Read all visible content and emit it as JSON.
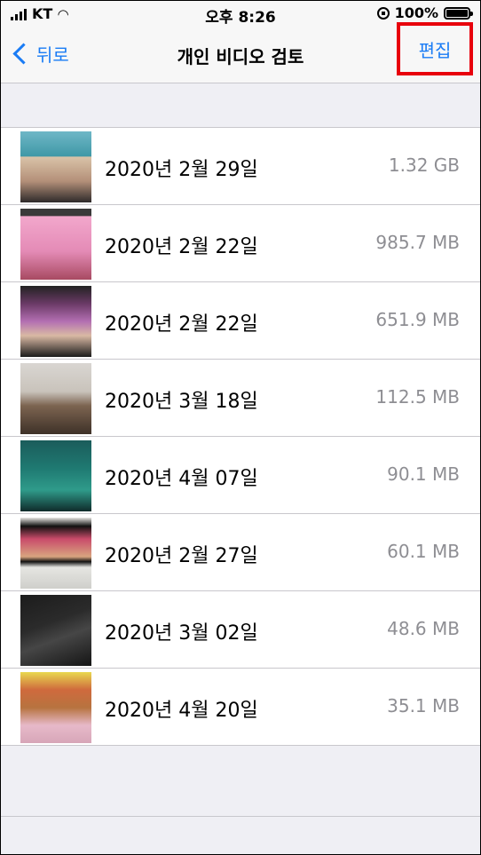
{
  "status_bar": {
    "carrier": "KT",
    "time": "오후 8:26",
    "battery_percent": "100%",
    "battery_level": 1.0
  },
  "nav": {
    "back_label": "뒤로",
    "title": "개인 비디오 검토",
    "edit_label": "편집",
    "highlight_color": "#e8000c",
    "accent_color": "#1a7cf5"
  },
  "videos": [
    {
      "date": "2020년 2월 29일",
      "size": "1.32 GB",
      "thumb": "video-thumbnail"
    },
    {
      "date": "2020년 2월 22일",
      "size": "985.7 MB",
      "thumb": "video-thumbnail"
    },
    {
      "date": "2020년 2월 22일",
      "size": "651.9 MB",
      "thumb": "video-thumbnail"
    },
    {
      "date": "2020년 3월 18일",
      "size": "112.5 MB",
      "thumb": "video-thumbnail"
    },
    {
      "date": "2020년 4월 07일",
      "size": "90.1 MB",
      "thumb": "video-thumbnail"
    },
    {
      "date": "2020년 2월 27일",
      "size": "60.1 MB",
      "thumb": "video-thumbnail"
    },
    {
      "date": "2020년 3월 02일",
      "size": "48.6 MB",
      "thumb": "video-thumbnail"
    },
    {
      "date": "2020년 4월 20일",
      "size": "35.1 MB",
      "thumb": "video-thumbnail"
    }
  ]
}
